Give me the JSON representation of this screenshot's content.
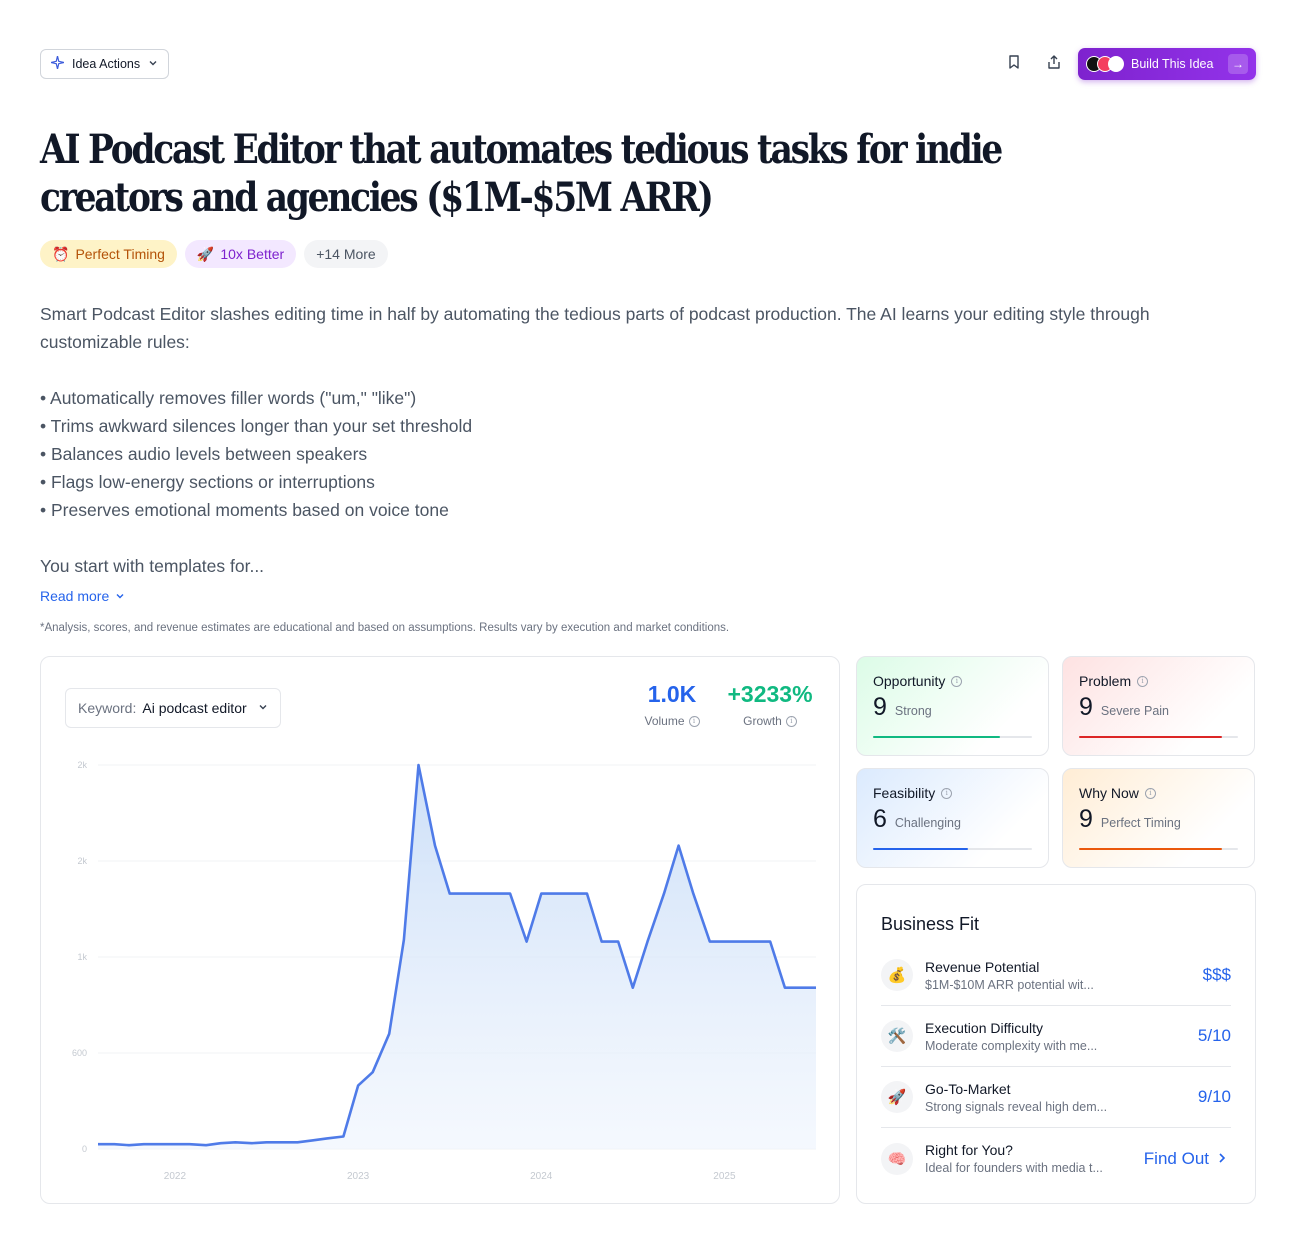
{
  "topbar": {
    "idea_actions_label": "Idea Actions",
    "build_label": "Build This Idea"
  },
  "title": "AI Podcast Editor that automates tedious tasks for indie creators and agencies ($1M-$5M ARR)",
  "tags": [
    {
      "emoji": "⏰",
      "label": "Perfect Timing"
    },
    {
      "emoji": "🚀",
      "label": "10x Better"
    },
    {
      "emoji": "",
      "label": "+14 More"
    }
  ],
  "description": {
    "intro": "Smart Podcast Editor slashes editing time in half by automating the tedious parts of podcast production. The AI learns your editing style through customizable rules:",
    "bullets": [
      "• Automatically removes filler words (\"um,\" \"like\")",
      "• Trims awkward silences longer than your set threshold",
      "• Balances audio levels between speakers",
      "• Flags low-energy sections or interruptions",
      "• Preserves emotional moments based on voice tone"
    ],
    "outro": "You start with templates for..."
  },
  "read_more": "Read more",
  "disclaimer": "*Analysis, scores, and revenue estimates are educational and based on assumptions. Results vary by execution and market conditions.",
  "keyword": {
    "label": "Keyword:",
    "value": "Ai podcast editor"
  },
  "stats": {
    "volume": {
      "value": "1.0K",
      "label": "Volume",
      "color": "#2563eb"
    },
    "growth": {
      "value": "+3233%",
      "label": "Growth",
      "color": "#10b981"
    }
  },
  "chart_data": {
    "type": "area",
    "title": "",
    "xlabel": "",
    "ylabel": "",
    "y_tick_labels": [
      "0",
      "600",
      "1k",
      "2k",
      "2k"
    ],
    "y_tick_values": [
      0,
      500,
      1000,
      1500,
      2000
    ],
    "ylim": [
      0,
      2000
    ],
    "x_tick_labels": [
      "2022",
      "2023",
      "2024",
      "2025"
    ],
    "x_tick_values": [
      2022.0,
      2023.0,
      2024.0,
      2025.0
    ],
    "xlim": [
      2021.58,
      2025.5
    ],
    "grid": true,
    "color": "#4f7be8",
    "x": [
      2021.58,
      2021.67,
      2021.75,
      2021.83,
      2021.92,
      2022.0,
      2022.08,
      2022.17,
      2022.25,
      2022.33,
      2022.42,
      2022.5,
      2022.58,
      2022.67,
      2022.75,
      2022.83,
      2022.92,
      2023.0,
      2023.08,
      2023.17,
      2023.25,
      2023.33,
      2023.42,
      2023.5,
      2023.58,
      2023.67,
      2023.75,
      2023.83,
      2023.92,
      2024.0,
      2024.08,
      2024.17,
      2024.25,
      2024.33,
      2024.42,
      2024.5,
      2024.58,
      2024.67,
      2024.75,
      2024.83,
      2024.92,
      2025.0,
      2025.08,
      2025.17,
      2025.25,
      2025.33,
      2025.42,
      2025.5
    ],
    "values": [
      25,
      25,
      20,
      25,
      25,
      25,
      25,
      20,
      30,
      35,
      30,
      35,
      35,
      35,
      45,
      55,
      65,
      330,
      400,
      600,
      1090,
      2000,
      1580,
      1330,
      1330,
      1330,
      1330,
      1330,
      1080,
      1330,
      1330,
      1330,
      1330,
      1080,
      1080,
      840,
      1080,
      1330,
      1580,
      1330,
      1080,
      1080,
      1080,
      1080,
      1080,
      840,
      840,
      840
    ]
  },
  "scores": [
    {
      "name": "Opportunity",
      "value": "9",
      "desc": "Strong",
      "fill": 0.8,
      "color": "#10b981"
    },
    {
      "name": "Problem",
      "value": "9",
      "desc": "Severe Pain",
      "fill": 0.9,
      "color": "#dc2626"
    },
    {
      "name": "Feasibility",
      "value": "6",
      "desc": "Challenging",
      "fill": 0.6,
      "color": "#2563eb"
    },
    {
      "name": "Why Now",
      "value": "9",
      "desc": "Perfect Timing",
      "fill": 0.9,
      "color": "#ea580c"
    }
  ],
  "business_fit": {
    "title": "Business Fit",
    "rows": [
      {
        "icon": "💰",
        "title": "Revenue Potential",
        "subtitle": "$1M-$10M ARR potential wit...",
        "value": "$$$"
      },
      {
        "icon": "🛠️",
        "title": "Execution Difficulty",
        "subtitle": "Moderate complexity with me...",
        "value": "5/10"
      },
      {
        "icon": "🚀",
        "title": "Go-To-Market",
        "subtitle": "Strong signals reveal high dem...",
        "value": "9/10"
      },
      {
        "icon": "🧠",
        "title": "Right for You?",
        "subtitle": "Ideal for founders with media t...",
        "value": "Find Out"
      }
    ]
  }
}
